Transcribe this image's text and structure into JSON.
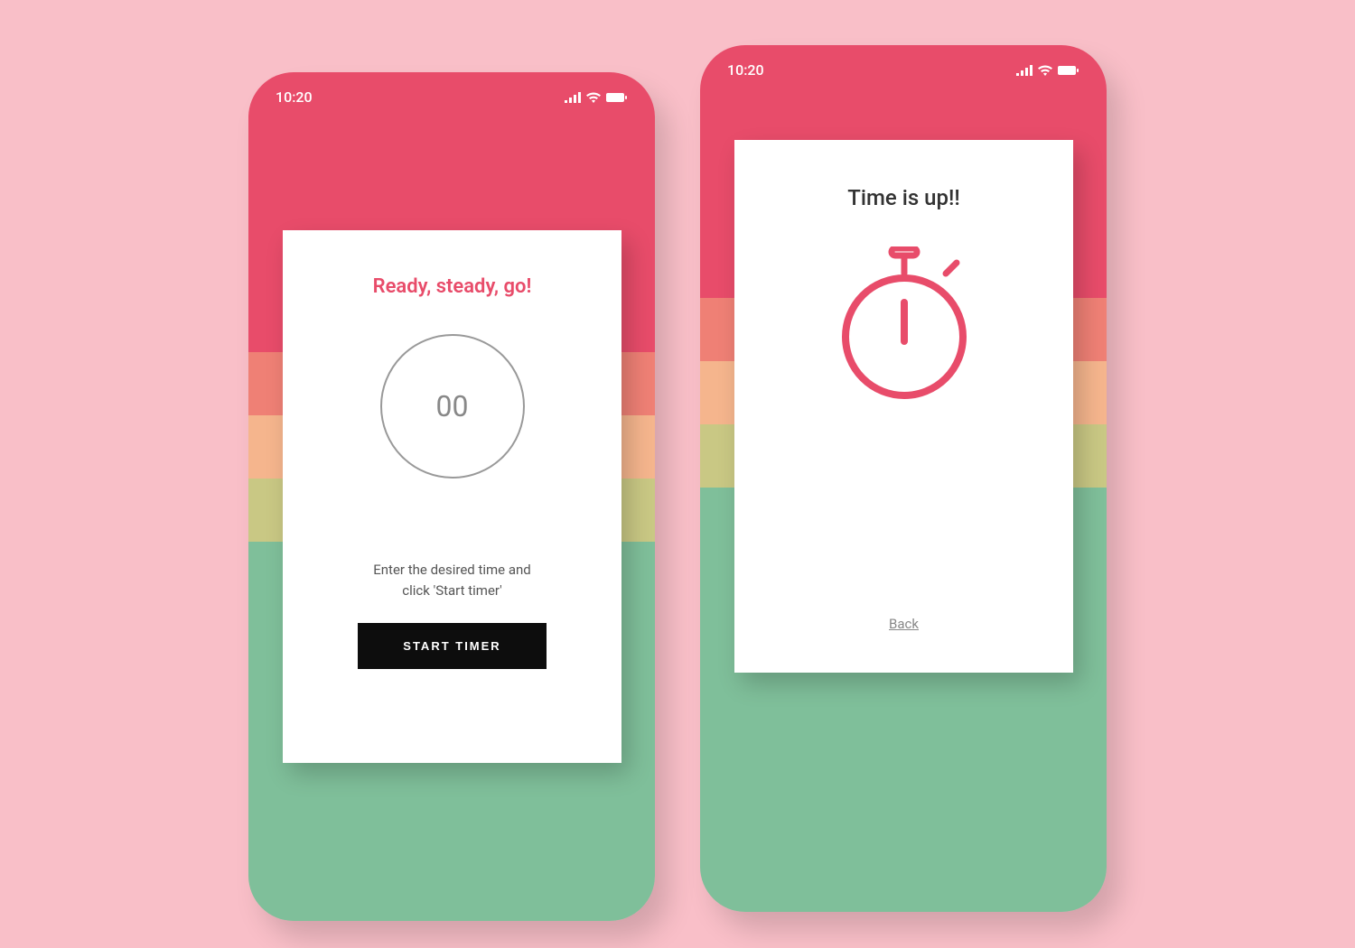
{
  "status_bar": {
    "time": "10:20"
  },
  "screen1": {
    "title": "Ready, steady, go!",
    "timer_value": "00",
    "instruction": "Enter the desired time and click 'Start timer'",
    "button_label": "START TIMER"
  },
  "screen2": {
    "title": "Time is up!!",
    "back_label": "Back"
  },
  "colors": {
    "accent": "#e84c6a",
    "stripe2": "#ef8075",
    "stripe3": "#f5b58d",
    "stripe4": "#c9c884",
    "stripe5": "#7fbf9a",
    "button_bg": "#0d0d0d"
  }
}
